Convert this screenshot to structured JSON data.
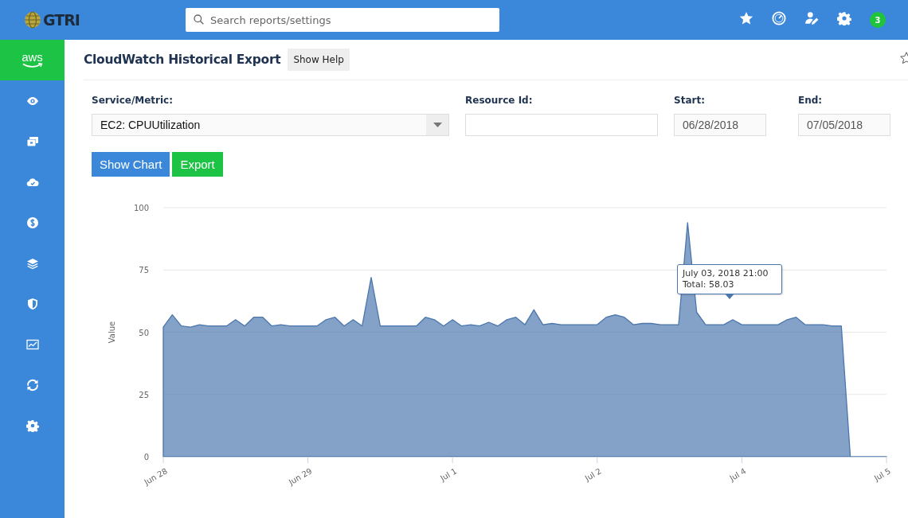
{
  "topbar": {
    "logo": "GTRI",
    "search": {
      "placeholder": "Search reports/settings"
    },
    "icons": [
      {
        "kind": "star"
      },
      {
        "kind": "gauge"
      },
      {
        "kind": "user-edit"
      },
      {
        "kind": "gear"
      }
    ],
    "notification_count": "3"
  },
  "sidebar": {
    "items": [
      {
        "kind": "aws",
        "label": "aws",
        "selected": true
      },
      {
        "kind": "eye",
        "selected": false
      },
      {
        "kind": "cards",
        "selected": false
      },
      {
        "kind": "cloud",
        "selected": false
      },
      {
        "kind": "dollar",
        "selected": false
      },
      {
        "kind": "layers",
        "selected": false
      },
      {
        "kind": "shield",
        "selected": false
      },
      {
        "kind": "chart",
        "selected": false
      },
      {
        "kind": "sync",
        "selected": false
      },
      {
        "kind": "gear",
        "selected": false
      }
    ]
  },
  "page": {
    "title": "CloudWatch Historical Export",
    "help_button": "Show Help",
    "favorite": false
  },
  "form": {
    "fields": [
      {
        "kind": "select",
        "label": "Service/Metric:",
        "value": "EC2: CPUUtilization"
      },
      {
        "kind": "text",
        "label": "Resource Id:"
      },
      {
        "kind": "date",
        "label": "Start:",
        "value": "06/28/2018"
      },
      {
        "kind": "date",
        "label": "End:",
        "value": "07/05/2018"
      }
    ],
    "buttons": [
      {
        "kind": "primary",
        "label": "Show Chart"
      },
      {
        "kind": "success",
        "label": "Export"
      }
    ]
  },
  "chart": {
    "chart_data": {
      "type": "area",
      "ylabel": "Value",
      "categories": [
        "Jun 28",
        null,
        null,
        null,
        null,
        null,
        null,
        null,
        null,
        null,
        null,
        null,
        null,
        null,
        null,
        null,
        "Jun 29",
        null,
        null,
        null,
        null,
        null,
        null,
        null,
        null,
        null,
        null,
        null,
        null,
        null,
        null,
        null,
        "Jul 1",
        null,
        null,
        null,
        null,
        null,
        null,
        null,
        null,
        null,
        null,
        null,
        null,
        null,
        null,
        null,
        "Jul 2",
        null,
        null,
        null,
        null,
        null,
        null,
        null,
        null,
        null,
        null,
        null,
        null,
        null,
        null,
        null,
        "Jul 4",
        null,
        null,
        null,
        null,
        null,
        null,
        null,
        null,
        null,
        null,
        null,
        null,
        null,
        null,
        null,
        "Jul 5"
      ],
      "series": [
        {
          "color": "#4a76ad",
          "values": [
            52,
            57,
            52.5,
            52,
            53,
            52.5,
            52.5,
            52.5,
            55,
            52.5,
            56,
            56,
            52.5,
            53,
            52.5,
            52.5,
            52.5,
            52.5,
            55,
            56,
            52.5,
            55,
            52.5,
            72,
            52.5,
            52.5,
            52.5,
            52.5,
            52.5,
            56,
            55,
            52.5,
            55,
            52.5,
            53,
            52.5,
            54,
            52.5,
            55,
            56,
            53,
            59,
            53,
            53.5,
            53,
            53,
            53,
            53,
            53,
            56,
            57,
            56,
            53,
            53.5,
            53.5,
            53,
            53,
            53,
            94,
            58,
            53,
            53,
            53,
            55,
            53,
            53,
            53,
            53,
            53,
            55,
            56,
            53,
            53,
            53,
            52.5,
            52.5,
            0,
            0,
            0,
            0,
            0
          ]
        }
      ],
      "ylim": [
        0,
        100
      ],
      "yticks": [
        0,
        25,
        50,
        75,
        100
      ],
      "grid": true,
      "annotations": [
        {
          "text": "July 03, 2018 21:00\nTotal: 58.03"
        }
      ]
    }
  }
}
